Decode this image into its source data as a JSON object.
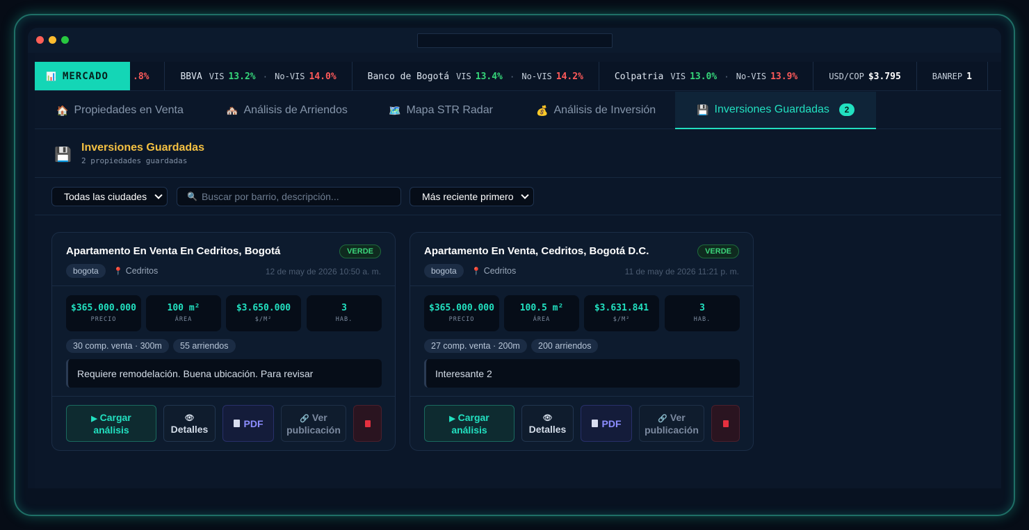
{
  "ticker": {
    "label": "MERCADO",
    "label_icon": "bar-chart-icon",
    "lead_fragment": ".8%",
    "items": [
      {
        "bank": "BBVA",
        "vis_label": "VIS",
        "vis": "13.2%",
        "novis_label": "No-VIS",
        "novis": "14.0%"
      },
      {
        "bank": "Banco de Bogotá",
        "vis_label": "VIS",
        "vis": "13.4%",
        "novis_label": "No-VIS",
        "novis": "14.2%"
      },
      {
        "bank": "Colpatria",
        "vis_label": "VIS",
        "vis": "13.0%",
        "novis_label": "No-VIS",
        "novis": "13.9%"
      }
    ],
    "sep": "·",
    "fx_label": "USD/COP",
    "fx_value": "$3.795",
    "banrep_label": "BANREP",
    "banrep_fragment": "1"
  },
  "tabs": [
    {
      "icon": "🏠",
      "label": "Propiedades en Venta"
    },
    {
      "icon": "🏘️",
      "label": "Análisis de Arriendos"
    },
    {
      "icon": "🗺️",
      "label": "Mapa STR Radar"
    },
    {
      "icon": "💰",
      "label": "Análisis de Inversión"
    },
    {
      "icon": "💾",
      "label": "Inversiones Guardadas",
      "count": "2"
    }
  ],
  "section": {
    "icon": "💾",
    "title": "Inversiones Guardadas",
    "subtitle": "2 propiedades guardadas"
  },
  "filters": {
    "city_select": "Todas las ciudades",
    "search_placeholder": "Buscar por barrio, descripción...",
    "sort_select": "Más reciente primero"
  },
  "cards": [
    {
      "title": "Apartamento En Venta En Cedritos, Bogotá",
      "status": "VERDE",
      "city": "bogota",
      "barrio": "Cedritos",
      "date": "12 de may de 2026 10:50 a. m.",
      "stats": [
        {
          "value": "$365.000.000",
          "label": "PRECIO"
        },
        {
          "value": "100 m²",
          "label": "ÁREA"
        },
        {
          "value": "$3.650.000",
          "label": "$/M²"
        },
        {
          "value": "3",
          "label": "HAB."
        }
      ],
      "comps": "30 comp. venta · 300m",
      "rentals": "55 arriendos",
      "note": "Requiere remodelación. Buena ubicación. Para revisar"
    },
    {
      "title": "Apartamento En Venta, Cedritos, Bogotá D.C.",
      "status": "VERDE",
      "city": "bogota",
      "barrio": "Cedritos",
      "date": "11 de may de 2026 11:21 p. m.",
      "stats": [
        {
          "value": "$365.000.000",
          "label": "PRECIO"
        },
        {
          "value": "100.5 m²",
          "label": "ÁREA"
        },
        {
          "value": "$3.631.841",
          "label": "$/M²"
        },
        {
          "value": "3",
          "label": "HAB."
        }
      ],
      "comps": "27 comp. venta · 200m",
      "rentals": "200 arriendos",
      "note": "Interesante 2"
    }
  ],
  "buttons": {
    "load_line1": "Cargar",
    "load_line2": "análisis",
    "details": "Detalles",
    "pdf": "PDF",
    "pub_line1": "Ver",
    "pub_line2": "publicación"
  },
  "colors": {
    "accent": "#22e0c0",
    "title_yellow": "#f5c142",
    "positive": "#36d67a",
    "negative": "#ff5a5a"
  }
}
